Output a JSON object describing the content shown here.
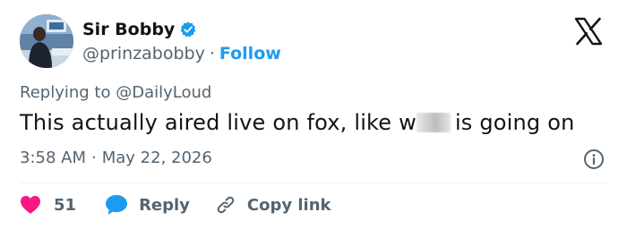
{
  "author": {
    "display_name": "Sir Bobby",
    "handle": "@prinzabobby",
    "separator": "·",
    "follow_label": "Follow",
    "verified": true
  },
  "tweet": {
    "replying_prefix": "Replying to ",
    "replying_to": "@DailyLoud",
    "text_before": "This actually aired live on fox, like w",
    "text_after": "is going on",
    "time": "3:58 AM",
    "date_separator": "·",
    "date": "May 22, 2026"
  },
  "actions": {
    "like_count": "51",
    "reply_label": "Reply",
    "copy_label": "Copy link"
  },
  "icons": {
    "verified": "verified-badge-icon",
    "brand": "x-logo-icon",
    "info": "info-icon",
    "like": "heart-icon",
    "reply": "speech-bubble-icon",
    "copy": "link-icon"
  },
  "colors": {
    "accent": "#1d9bf0",
    "like": "#f91880",
    "muted_text": "#536471",
    "text": "#0f1419"
  }
}
